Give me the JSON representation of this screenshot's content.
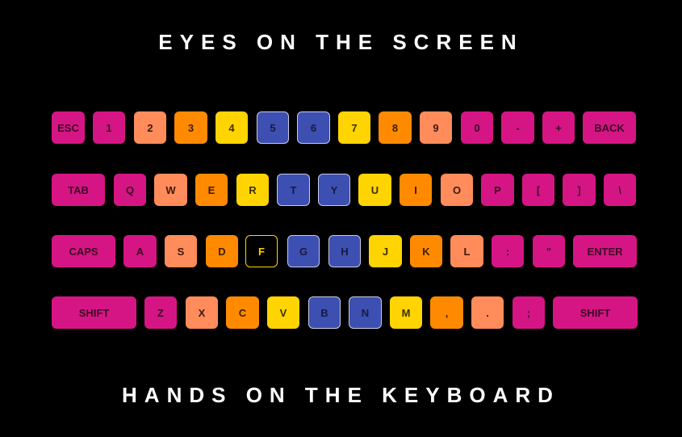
{
  "headings": {
    "top": "EYES ON THE SCREEN",
    "bottom": "HANDS ON THE KEYBOARD"
  },
  "colors": {
    "pink": "#d61585",
    "salmon": "#ff8c5a",
    "orange": "#ff8a00",
    "yellow": "#ffd400",
    "blue": "#3d4fb0",
    "background": "#000000"
  },
  "keyboard": {
    "rows": [
      [
        {
          "label": "ESC",
          "color": "pink"
        },
        {
          "label": "1",
          "color": "pink"
        },
        {
          "label": "2",
          "color": "salmon"
        },
        {
          "label": "3",
          "color": "orange"
        },
        {
          "label": "4",
          "color": "yellow"
        },
        {
          "label": "5",
          "color": "blue"
        },
        {
          "label": "6",
          "color": "blue"
        },
        {
          "label": "7",
          "color": "yellow"
        },
        {
          "label": "8",
          "color": "orange"
        },
        {
          "label": "9",
          "color": "salmon"
        },
        {
          "label": "0",
          "color": "pink"
        },
        {
          "label": "-",
          "color": "pink"
        },
        {
          "label": "+",
          "color": "pink"
        },
        {
          "label": "BACK",
          "color": "pink"
        }
      ],
      [
        {
          "label": "TAB",
          "color": "pink"
        },
        {
          "label": "Q",
          "color": "pink"
        },
        {
          "label": "W",
          "color": "salmon"
        },
        {
          "label": "E",
          "color": "orange"
        },
        {
          "label": "R",
          "color": "yellow"
        },
        {
          "label": "T",
          "color": "blue"
        },
        {
          "label": "Y",
          "color": "blue"
        },
        {
          "label": "U",
          "color": "yellow"
        },
        {
          "label": "I",
          "color": "orange"
        },
        {
          "label": "O",
          "color": "salmon"
        },
        {
          "label": "P",
          "color": "pink"
        },
        {
          "label": "[",
          "color": "pink"
        },
        {
          "label": "]",
          "color": "pink"
        },
        {
          "label": "\\",
          "color": "pink"
        }
      ],
      [
        {
          "label": "CAPS",
          "color": "pink"
        },
        {
          "label": "A",
          "color": "pink"
        },
        {
          "label": "S",
          "color": "salmon"
        },
        {
          "label": "D",
          "color": "orange"
        },
        {
          "label": "F",
          "color": "home"
        },
        {
          "label": "G",
          "color": "blue"
        },
        {
          "label": "H",
          "color": "blue"
        },
        {
          "label": "J",
          "color": "yellow"
        },
        {
          "label": "K",
          "color": "orange"
        },
        {
          "label": "L",
          "color": "salmon"
        },
        {
          "label": ":",
          "color": "pink"
        },
        {
          "label": "\"",
          "color": "pink"
        },
        {
          "label": "ENTER",
          "color": "pink"
        }
      ],
      [
        {
          "label": "SHIFT",
          "color": "pink"
        },
        {
          "label": "Z",
          "color": "pink"
        },
        {
          "label": "X",
          "color": "salmon"
        },
        {
          "label": "C",
          "color": "orange"
        },
        {
          "label": "V",
          "color": "yellow"
        },
        {
          "label": "B",
          "color": "blue"
        },
        {
          "label": "N",
          "color": "blue"
        },
        {
          "label": "M",
          "color": "yellow"
        },
        {
          "label": ",",
          "color": "orange"
        },
        {
          "label": ".",
          "color": "salmon"
        },
        {
          "label": ";",
          "color": "pink"
        },
        {
          "label": "SHIFT",
          "color": "pink"
        }
      ]
    ]
  }
}
